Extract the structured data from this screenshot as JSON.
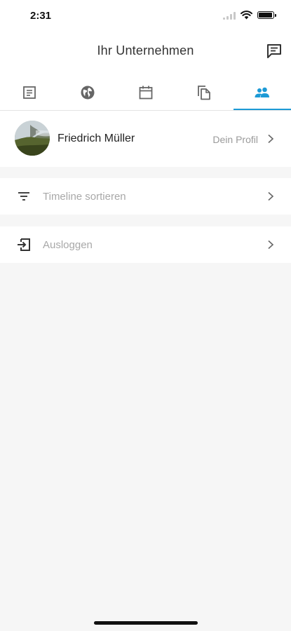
{
  "status_bar": {
    "time": "2:31"
  },
  "header": {
    "title": "Ihr Unternehmen",
    "action_icon": "chat-icon"
  },
  "tabs": [
    {
      "name": "feed",
      "icon": "document-icon",
      "active": false
    },
    {
      "name": "web",
      "icon": "globe-icon",
      "active": false
    },
    {
      "name": "calendar",
      "icon": "calendar-icon",
      "active": false
    },
    {
      "name": "documents",
      "icon": "copy-icon",
      "active": false
    },
    {
      "name": "people",
      "icon": "people-icon",
      "active": true
    }
  ],
  "profile": {
    "name": "Friedrich Müller",
    "link_label": "Dein Profil"
  },
  "menu": {
    "sort": {
      "label": "Timeline sortieren",
      "icon": "filter-icon"
    },
    "logout": {
      "label": "Ausloggen",
      "icon": "logout-icon"
    }
  },
  "colors": {
    "accent": "#1c9ad6",
    "background": "#f6f6f6",
    "muted_text": "#a8a8a8"
  }
}
